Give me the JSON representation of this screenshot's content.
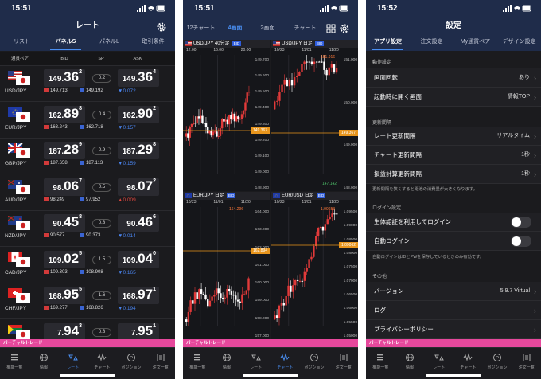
{
  "colors": {
    "header": "#1f2c4a",
    "accent": "#4a8ff2",
    "up": "#e0463e",
    "down": "#4a84ee",
    "virtual": "#e6489c",
    "priceLine": "#e8951d"
  },
  "virtual_label": "バーチャルトレード",
  "nav": [
    {
      "label": "機能一覧",
      "icon": "menu-icon"
    },
    {
      "label": "情報",
      "icon": "globe-icon"
    },
    {
      "label": "レート",
      "icon": "rate-icon"
    },
    {
      "label": "チャート",
      "icon": "chart-icon"
    },
    {
      "label": "ポジション",
      "icon": "position-icon"
    },
    {
      "label": "注文一覧",
      "icon": "order-list-icon"
    }
  ],
  "s1": {
    "time": "15:51",
    "title": "レート",
    "tabs": [
      "リスト",
      "パネルS",
      "パネルL",
      "取引条件"
    ],
    "cols": [
      "通貨ペア",
      "BID",
      "SP",
      "ASK"
    ],
    "rates": [
      {
        "pair": "USD/JPY",
        "bid_s": "149.",
        "bid_b": "36",
        "bid_t": "2",
        "sp": "0.2",
        "ask_s": "149.",
        "ask_b": "36",
        "ask_t": "4",
        "hi": "149.713",
        "lo": "149.192",
        "chg": "0.072",
        "dir": "dn"
      },
      {
        "pair": "EUR/JPY",
        "bid_s": "162.",
        "bid_b": "89",
        "bid_t": "8",
        "sp": "0.4",
        "ask_s": "162.",
        "ask_b": "90",
        "ask_t": "2",
        "hi": "163.243",
        "lo": "162.718",
        "chg": "0.157",
        "dir": "dn"
      },
      {
        "pair": "GBP/JPY",
        "bid_s": "187.",
        "bid_b": "28",
        "bid_t": "9",
        "sp": "0.9",
        "ask_s": "187.",
        "ask_b": "29",
        "ask_t": "8",
        "hi": "187.658",
        "lo": "187.113",
        "chg": "0.159",
        "dir": "dn"
      },
      {
        "pair": "AUD/JPY",
        "bid_s": "98.",
        "bid_b": "06",
        "bid_t": "7",
        "sp": "0.5",
        "ask_s": "98.",
        "ask_b": "07",
        "ask_t": "2",
        "hi": "98.249",
        "lo": "97.952",
        "chg": "0.009",
        "dir": "up"
      },
      {
        "pair": "NZD/JPY",
        "bid_s": "90.",
        "bid_b": "45",
        "bid_t": "8",
        "sp": "0.8",
        "ask_s": "90.",
        "ask_b": "46",
        "ask_t": "6",
        "hi": "90.577",
        "lo": "90.373",
        "chg": "0.014",
        "dir": "dn"
      },
      {
        "pair": "CAD/JPY",
        "bid_s": "109.",
        "bid_b": "02",
        "bid_t": "5",
        "sp": "1.5",
        "ask_s": "109.",
        "ask_b": "04",
        "ask_t": "0",
        "hi": "109.303",
        "lo": "108.908",
        "chg": "0.165",
        "dir": "dn"
      },
      {
        "pair": "CHF/JPY",
        "bid_s": "168.",
        "bid_b": "95",
        "bid_t": "5",
        "sp": "1.6",
        "ask_s": "168.",
        "ask_b": "97",
        "ask_t": "1",
        "hi": "169.277",
        "lo": "168.826",
        "chg": "0.194",
        "dir": "dn"
      },
      {
        "pair": "ZAR/JPY",
        "bid_s": "7.",
        "bid_b": "94",
        "bid_t": "3",
        "sp": "0.8",
        "ask_s": "7.",
        "ask_b": "95",
        "ask_t": "1",
        "hi": "",
        "lo": "",
        "chg": "",
        "dir": "dn"
      }
    ]
  },
  "s2": {
    "time": "15:51",
    "tabs": [
      "12チャート",
      "4画面",
      "2画面",
      "チャート"
    ],
    "panels": [
      {
        "pair": "USD/JPY",
        "tf": "40分足",
        "bid": "BID",
        "dates": [
          "12:00",
          "16:00",
          "20:00"
        ],
        "axis": [
          "149.700",
          "149.600",
          "149.500",
          "149.400",
          "149.300",
          "149.200",
          "149.100",
          "149.000",
          "148.900"
        ],
        "cur": "149.367"
      },
      {
        "pair": "USD/JPY",
        "tf": "日足",
        "bid": "BID",
        "dates": [
          "10/23",
          "11/01",
          "11/20"
        ],
        "axis": [
          "151.000",
          "150.000",
          "149.000",
          "148.000"
        ],
        "cur": "149.367",
        "hi": "151.916",
        "lo": "147.142"
      },
      {
        "pair": "EUR/JPY",
        "tf": "日足",
        "bid": "BID",
        "dates": [
          "10/23",
          "11/01",
          "11/20"
        ],
        "axis": [
          "164.000",
          "163.000",
          "162.000",
          "161.000",
          "160.000",
          "159.000",
          "158.000",
          "157.000"
        ],
        "cur": "162.894",
        "hi": "164.296"
      },
      {
        "pair": "EUR/USD",
        "tf": "日足",
        "bid": "BID",
        "dates": [
          "10/23",
          "11/01",
          "11/20"
        ],
        "axis": [
          "1.09500",
          "1.09000",
          "1.08500",
          "1.08000",
          "1.07500",
          "1.07000",
          "1.06500",
          "1.06000",
          "1.05500",
          "1.05000"
        ],
        "cur": "1.09062",
        "hi": "1.09653"
      }
    ]
  },
  "s3": {
    "time": "15:52",
    "title": "設定",
    "tabs": [
      "アプリ設定",
      "注文設定",
      "My通貨ペア",
      "デザイン設定"
    ],
    "sec_op": "動作設定",
    "rot": {
      "label": "画面回転",
      "value": "あり"
    },
    "start": {
      "label": "起動時に開く画面",
      "value": "情報TOP"
    },
    "sec_upd": "更新間隔",
    "rate_upd": {
      "label": "レート更新間隔",
      "value": "リアルタイム"
    },
    "chart_upd": {
      "label": "チャート更新間隔",
      "value": "1秒"
    },
    "pl_upd": {
      "label": "損益計算更新間隔",
      "value": "1秒"
    },
    "upd_note": "更新間隔を狭くすると電池の消費量が大きくなります。",
    "sec_login": "ログイン設定",
    "bio": {
      "label": "生体認証を利用してログイン"
    },
    "auto": {
      "label": "自動ログイン"
    },
    "login_note": "自動ログインはIDとPWを保存しているときのみ有効です。",
    "sec_other": "その他",
    "ver": {
      "label": "バージョン",
      "value": "5.9.7 Virtual"
    },
    "log": {
      "label": "ログ"
    },
    "privacy": {
      "label": "プライバシーポリシー"
    }
  }
}
